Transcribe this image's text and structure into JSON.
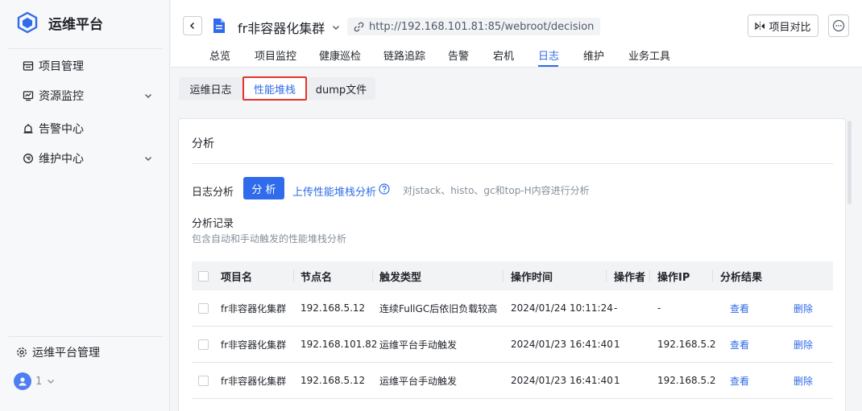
{
  "sidebar": {
    "brand": "运维平台",
    "items": [
      {
        "label": "项目管理",
        "icon": "list-icon"
      },
      {
        "label": "资源监控",
        "icon": "monitor-icon"
      },
      {
        "label": "告警中心",
        "icon": "alarm-icon"
      },
      {
        "label": "维护中心",
        "icon": "maintenance-icon"
      }
    ],
    "admin_label": "运维平台管理",
    "user_count": "1"
  },
  "header": {
    "project_title": "fr非容器化集群",
    "url": "http://192.168.101.81:85/webroot/decision",
    "compare_label": "项目对比",
    "tabs": [
      "总览",
      "项目监控",
      "健康巡检",
      "链路追踪",
      "告警",
      "宕机",
      "日志",
      "维护",
      "业务工具"
    ],
    "active_tab": "日志"
  },
  "subtabs": {
    "items": [
      "运维日志",
      "性能堆栈",
      "dump文件"
    ],
    "active": "性能堆栈"
  },
  "analysis": {
    "section_title": "分析",
    "row_label": "日志分析",
    "analyze_button": "分 析",
    "upload_link": "上传性能堆栈分析",
    "hint": "对jstack、histo、gc和top-H内容进行分析",
    "records_title": "分析记录",
    "records_subtitle": "包含自动和手动触发的性能堆栈分析"
  },
  "table": {
    "headers": [
      "项目名",
      "节点名",
      "触发类型",
      "操作时间",
      "操作者",
      "操作IP",
      "分析结果"
    ],
    "view_label": "查看",
    "delete_label": "删除",
    "rows": [
      {
        "project": "fr非容器化集群",
        "node": "192.168.5.12",
        "trigger": "连续FullGC后依旧负载较高",
        "time": "2024/01/24 10:11:24",
        "operator": "-",
        "ip": "-"
      },
      {
        "project": "fr非容器化集群",
        "node": "192.168.101.82",
        "trigger": "运维平台手动触发",
        "time": "2024/01/23 16:41:40",
        "operator": "1",
        "ip": "192.168.5.2"
      },
      {
        "project": "fr非容器化集群",
        "node": "192.168.5.12",
        "trigger": "运维平台手动触发",
        "time": "2024/01/23 16:41:40",
        "operator": "1",
        "ip": "192.168.5.2"
      }
    ]
  },
  "colors": {
    "accent": "#2f6bea",
    "highlight_border": "#e5322d"
  }
}
